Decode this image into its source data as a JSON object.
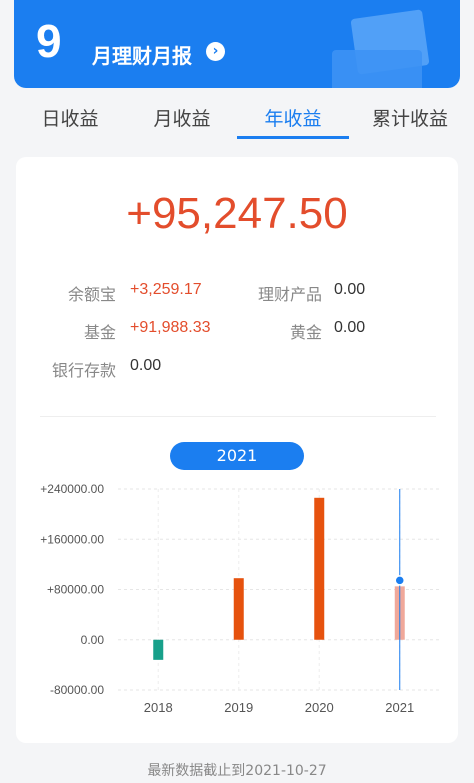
{
  "banner": {
    "month": "9",
    "title": "月理财月报",
    "arrow_icon": "chevron-right-circle-icon"
  },
  "tabs": [
    {
      "label": "日收益",
      "active": false
    },
    {
      "label": "月收益",
      "active": false
    },
    {
      "label": "年收益",
      "active": true
    },
    {
      "label": "累计收益",
      "active": false
    }
  ],
  "summary": {
    "total": "+95,247.50",
    "items": [
      {
        "label": "余额宝",
        "value": "+3,259.17",
        "positive": true
      },
      {
        "label": "理财产品",
        "value": "0.00",
        "positive": false
      },
      {
        "label": "基金",
        "value": "+91,988.33",
        "positive": true
      },
      {
        "label": "黄金",
        "value": "0.00",
        "positive": false
      },
      {
        "label": "银行存款",
        "value": "0.00",
        "positive": false
      }
    ]
  },
  "selected_year": "2021",
  "chart_data": {
    "type": "bar",
    "categories": [
      "2018",
      "2019",
      "2020",
      "2021"
    ],
    "values": [
      -32000,
      98000,
      226000,
      85000
    ],
    "ylim": [
      -80000,
      240000
    ],
    "yticks": [
      240000,
      160000,
      80000,
      0,
      -80000
    ],
    "ytick_labels": [
      "+240000.00",
      "+160000.00",
      "+80000.00",
      "0.00",
      "-80000.00"
    ],
    "selected_index": 3,
    "colors": {
      "positive": "#e6520e",
      "negative": "#17a08a",
      "selected": "#f0a89a",
      "cursor": "#1b7ef0"
    }
  },
  "footer": {
    "text": "最新数据截止到2021-10-27"
  }
}
